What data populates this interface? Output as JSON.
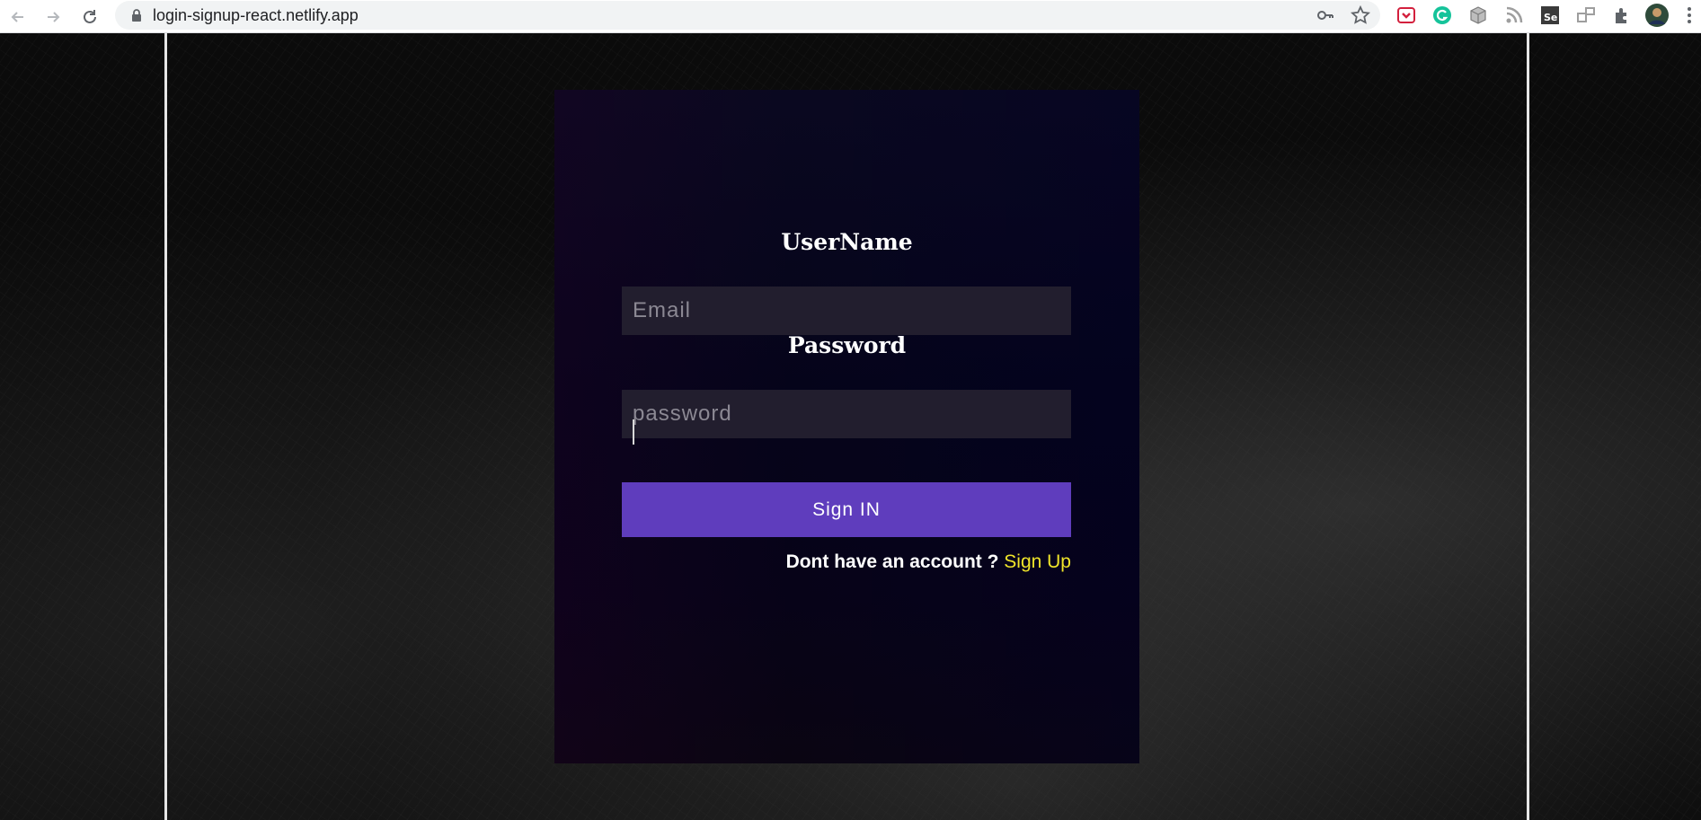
{
  "browser": {
    "url": "login-signup-react.netlify.app",
    "icons": {
      "back": "back-arrow-icon",
      "forward": "forward-arrow-icon",
      "reload": "reload-icon",
      "lock": "lock-icon",
      "key": "key-icon",
      "star": "bookmark-star-icon",
      "extensions": [
        "pocket-extension-icon",
        "grammarly-extension-icon",
        "cube-extension-icon",
        "rss-extension-icon",
        "selenium-extension-icon",
        "window-extension-icon",
        "puzzle-extensions-icon"
      ],
      "profile": "profile-avatar",
      "menu": "kebab-menu-icon"
    }
  },
  "form": {
    "username_label": "UserName",
    "email_placeholder": "Email",
    "email_value": "",
    "password_label": "Password",
    "password_placeholder": "password",
    "password_value": "",
    "submit_label": "Sign IN",
    "signup_prompt": "Dont have an account ?",
    "signup_link": "Sign Up"
  },
  "colors": {
    "button": "#5f3dbd",
    "link": "#f0e52a",
    "input_bg": "#221e2e",
    "card_bg": "#05041a"
  }
}
